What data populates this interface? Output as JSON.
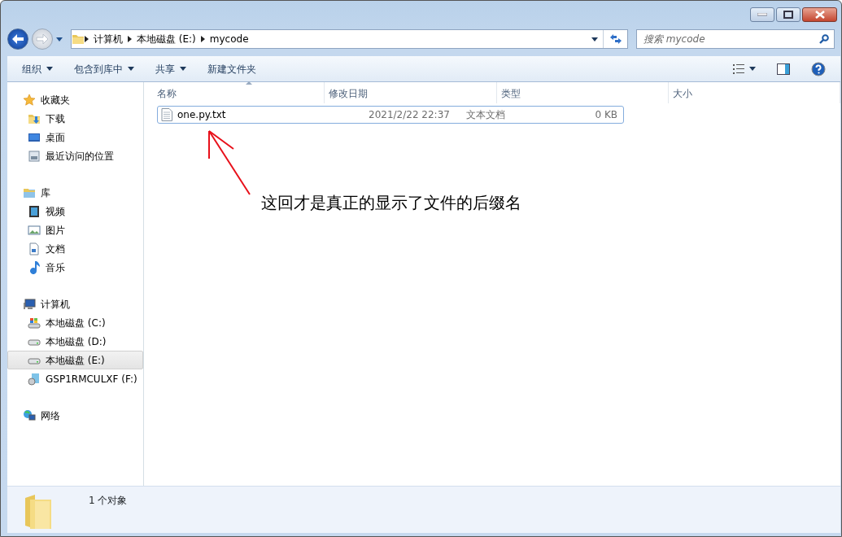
{
  "address": {
    "crumbs": [
      {
        "label": "计算机"
      },
      {
        "label": "本地磁盘 (E:)"
      },
      {
        "label": "mycode"
      }
    ]
  },
  "search": {
    "placeholder": "搜索 mycode"
  },
  "toolbar": [
    {
      "label": "组织",
      "dropdown": true
    },
    {
      "label": "包含到库中",
      "dropdown": true
    },
    {
      "label": "共享",
      "dropdown": true
    },
    {
      "label": "新建文件夹",
      "dropdown": false
    }
  ],
  "sidebar": [
    {
      "label": "收藏夹",
      "kind": "star",
      "selected": false,
      "children": [
        {
          "label": "下载",
          "kind": "download",
          "selected": false
        },
        {
          "label": "桌面",
          "kind": "desktop",
          "selected": false
        },
        {
          "label": "最近访问的位置",
          "kind": "recent",
          "selected": false
        }
      ]
    },
    {
      "label": "库",
      "kind": "library",
      "selected": false,
      "children": [
        {
          "label": "视频",
          "kind": "video",
          "selected": false
        },
        {
          "label": "图片",
          "kind": "picture",
          "selected": false
        },
        {
          "label": "文档",
          "kind": "document",
          "selected": false
        },
        {
          "label": "音乐",
          "kind": "music",
          "selected": false
        }
      ]
    },
    {
      "label": "计算机",
      "kind": "computer",
      "selected": false,
      "children": [
        {
          "label": "本地磁盘 (C:)",
          "kind": "system-drive",
          "selected": false
        },
        {
          "label": "本地磁盘 (D:)",
          "kind": "drive",
          "selected": false
        },
        {
          "label": "本地磁盘 (E:)",
          "kind": "drive",
          "selected": true
        },
        {
          "label": "GSP1RMCULXF (F:)",
          "kind": "disc",
          "selected": false
        }
      ]
    },
    {
      "label": "网络",
      "kind": "network",
      "selected": false
    }
  ],
  "table": {
    "columns": [
      {
        "label": "名称",
        "sorted": true
      },
      {
        "label": "修改日期",
        "sorted": false
      },
      {
        "label": "类型",
        "sorted": false
      },
      {
        "label": "大小",
        "sorted": false
      }
    ],
    "rows": [
      {
        "selected": true,
        "cells": [
          "one.py.txt",
          "2021/2/22 22:37",
          "文本文档",
          "0 KB"
        ]
      }
    ]
  },
  "annotation": {
    "text": "这回才是真正的显示了文件的后缀名"
  },
  "status_bar": {
    "text": "1 个对象"
  }
}
